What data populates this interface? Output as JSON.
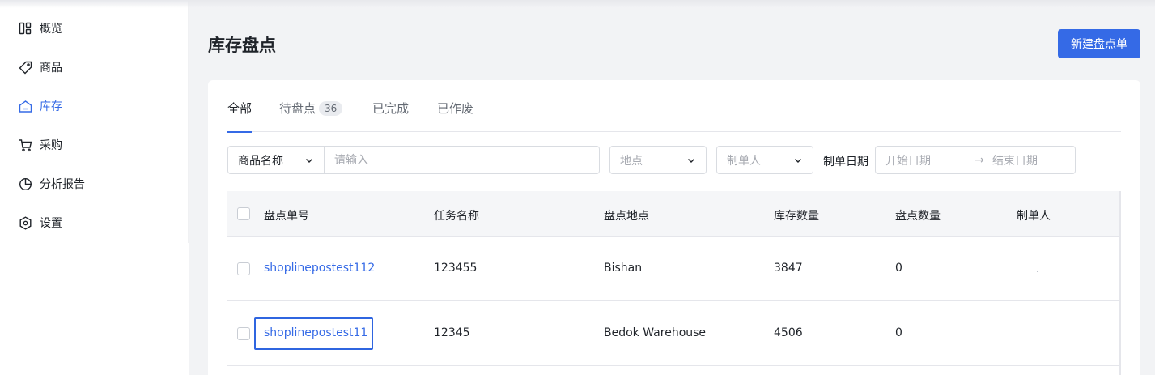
{
  "sidebar": {
    "items": [
      {
        "label": "概览",
        "icon": "overview-icon"
      },
      {
        "label": "商品",
        "icon": "tag-icon"
      },
      {
        "label": "库存",
        "icon": "warehouse-icon",
        "active": true
      },
      {
        "label": "采购",
        "icon": "cart-icon"
      },
      {
        "label": "分析报告",
        "icon": "pie-chart-icon"
      },
      {
        "label": "设置",
        "icon": "settings-icon"
      }
    ]
  },
  "header": {
    "title": "库存盘点",
    "new_button": "新建盘点单"
  },
  "tabs": [
    {
      "label": "全部",
      "active": true
    },
    {
      "label": "待盘点",
      "badge": "36"
    },
    {
      "label": "已完成"
    },
    {
      "label": "已作废"
    }
  ],
  "filters": {
    "field_select": "商品名称",
    "search_placeholder": "请输入",
    "location_placeholder": "地点",
    "creator_placeholder": "制单人",
    "date_label": "制单日期",
    "date_start": "开始日期",
    "date_arrow": "→",
    "date_end": "结束日期"
  },
  "table": {
    "headers": [
      "盘点单号",
      "任务名称",
      "盘点地点",
      "库存数量",
      "盘点数量",
      "制单人"
    ],
    "rows": [
      {
        "order_no": "shoplinepostest112",
        "task": "123455",
        "location": "Bishan",
        "stock": "3847",
        "counted": "0",
        "creator": ""
      },
      {
        "order_no": "shoplinepostest11",
        "task": "12345",
        "location": "Bedok Warehouse",
        "stock": "4506",
        "counted": "0",
        "creator": ""
      }
    ]
  },
  "colors": {
    "accent": "#356ae6",
    "background": "#f2f3f5"
  }
}
